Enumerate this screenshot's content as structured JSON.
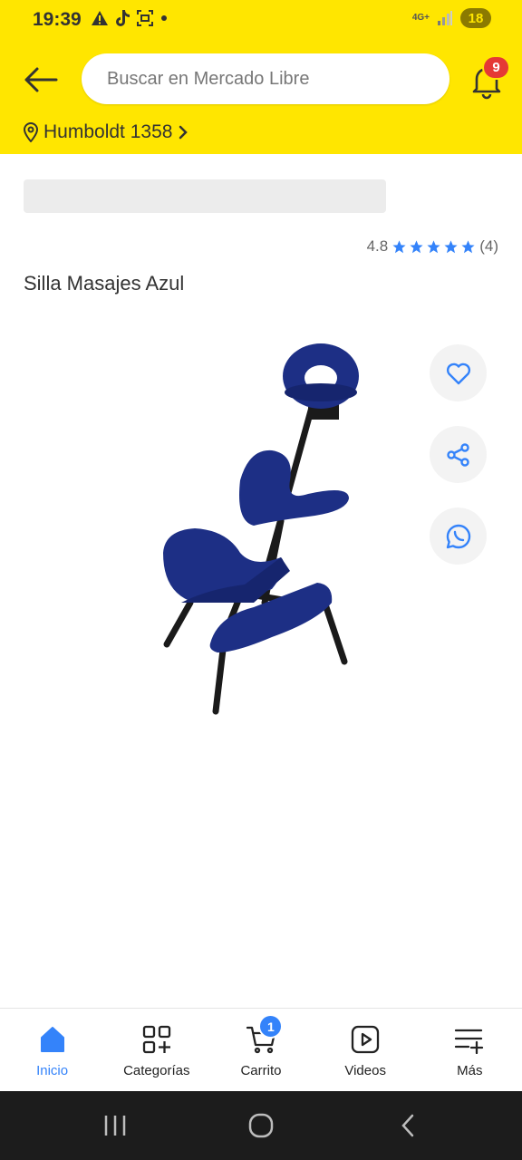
{
  "status_bar": {
    "time": "19:39",
    "network": "4G+",
    "battery": "18"
  },
  "header": {
    "search_placeholder": "Buscar en Mercado Libre",
    "notifications_count": "9",
    "address": "Humboldt 1358"
  },
  "product": {
    "rating": "4.8",
    "stars": 5,
    "reviews": "(4)",
    "title": "Silla Masajes Azul"
  },
  "bottom_nav": {
    "items": [
      {
        "label": "Inicio",
        "icon": "home-icon",
        "active": true
      },
      {
        "label": "Categorías",
        "icon": "categories-icon"
      },
      {
        "label": "Carrito",
        "icon": "cart-icon",
        "badge": "1"
      },
      {
        "label": "Videos",
        "icon": "video-icon"
      },
      {
        "label": "Más",
        "icon": "more-icon"
      }
    ]
  },
  "colors": {
    "brand_yellow": "#ffe600",
    "accent_blue": "#3483fa",
    "badge_red": "#e53935",
    "chair_blue": "#1d2f85"
  }
}
